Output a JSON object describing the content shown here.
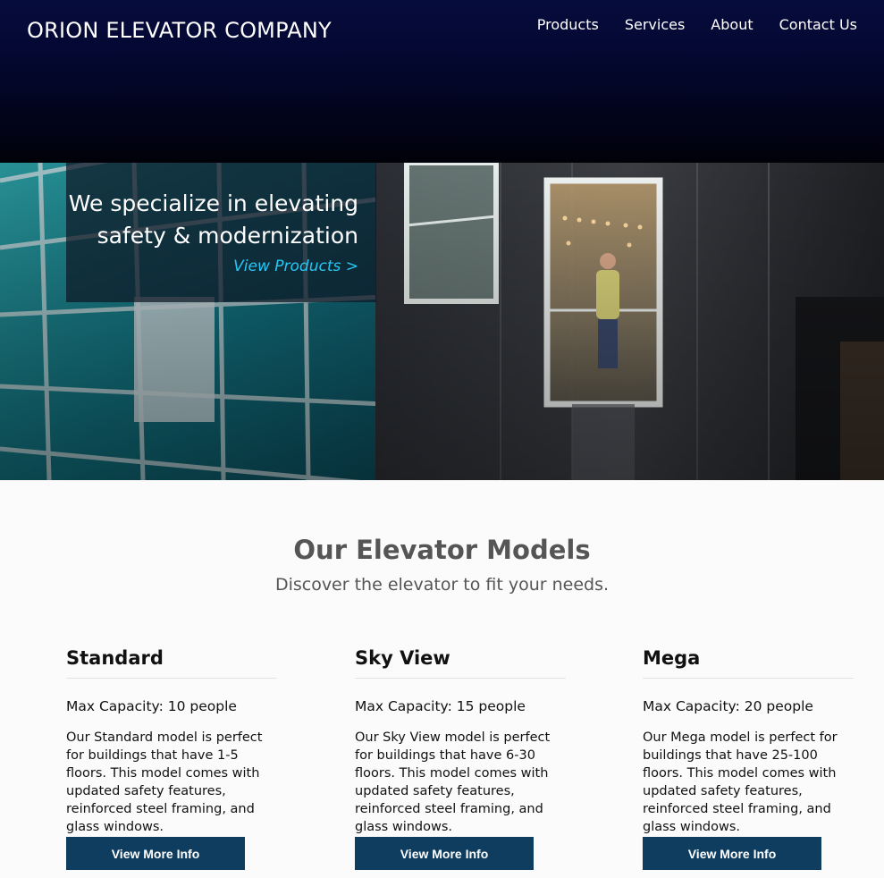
{
  "header": {
    "brand": "ORION ELEVATOR COMPANY",
    "background_color": "#02041c",
    "nav": [
      {
        "label": "Products"
      },
      {
        "label": "Services"
      },
      {
        "label": "About"
      },
      {
        "label": "Contact Us"
      }
    ]
  },
  "hero": {
    "heading_line1": "We specialize in elevating",
    "heading_line2": "safety & modernization",
    "link_label": "View Products >",
    "link_color": "#25c8f5"
  },
  "models_section": {
    "title": "Our Elevator Models",
    "subtitle": "Discover the elevator to fit your needs.",
    "button_color": "#0f3d5f",
    "models": [
      {
        "name": "Standard",
        "capacity": "Max Capacity: 10 people",
        "description": "Our Standard model is perfect for buildings that have 1-5 floors. This model comes with updated safety features, reinforced steel framing, and glass windows.",
        "button_label": "View More Info"
      },
      {
        "name": "Sky View",
        "capacity": "Max Capacity: 15 people",
        "description": "Our Sky View model is perfect for buildings that have 6-30 floors. This model comes with updated safety features, reinforced steel framing, and glass windows.",
        "button_label": "View More Info"
      },
      {
        "name": "Mega",
        "capacity": "Max Capacity: 20 people",
        "description": "Our Mega model is perfect for buildings that have 25-100 floors. This model comes with updated safety features, reinforced steel framing, and glass windows.",
        "button_label": "View More Info"
      }
    ]
  }
}
